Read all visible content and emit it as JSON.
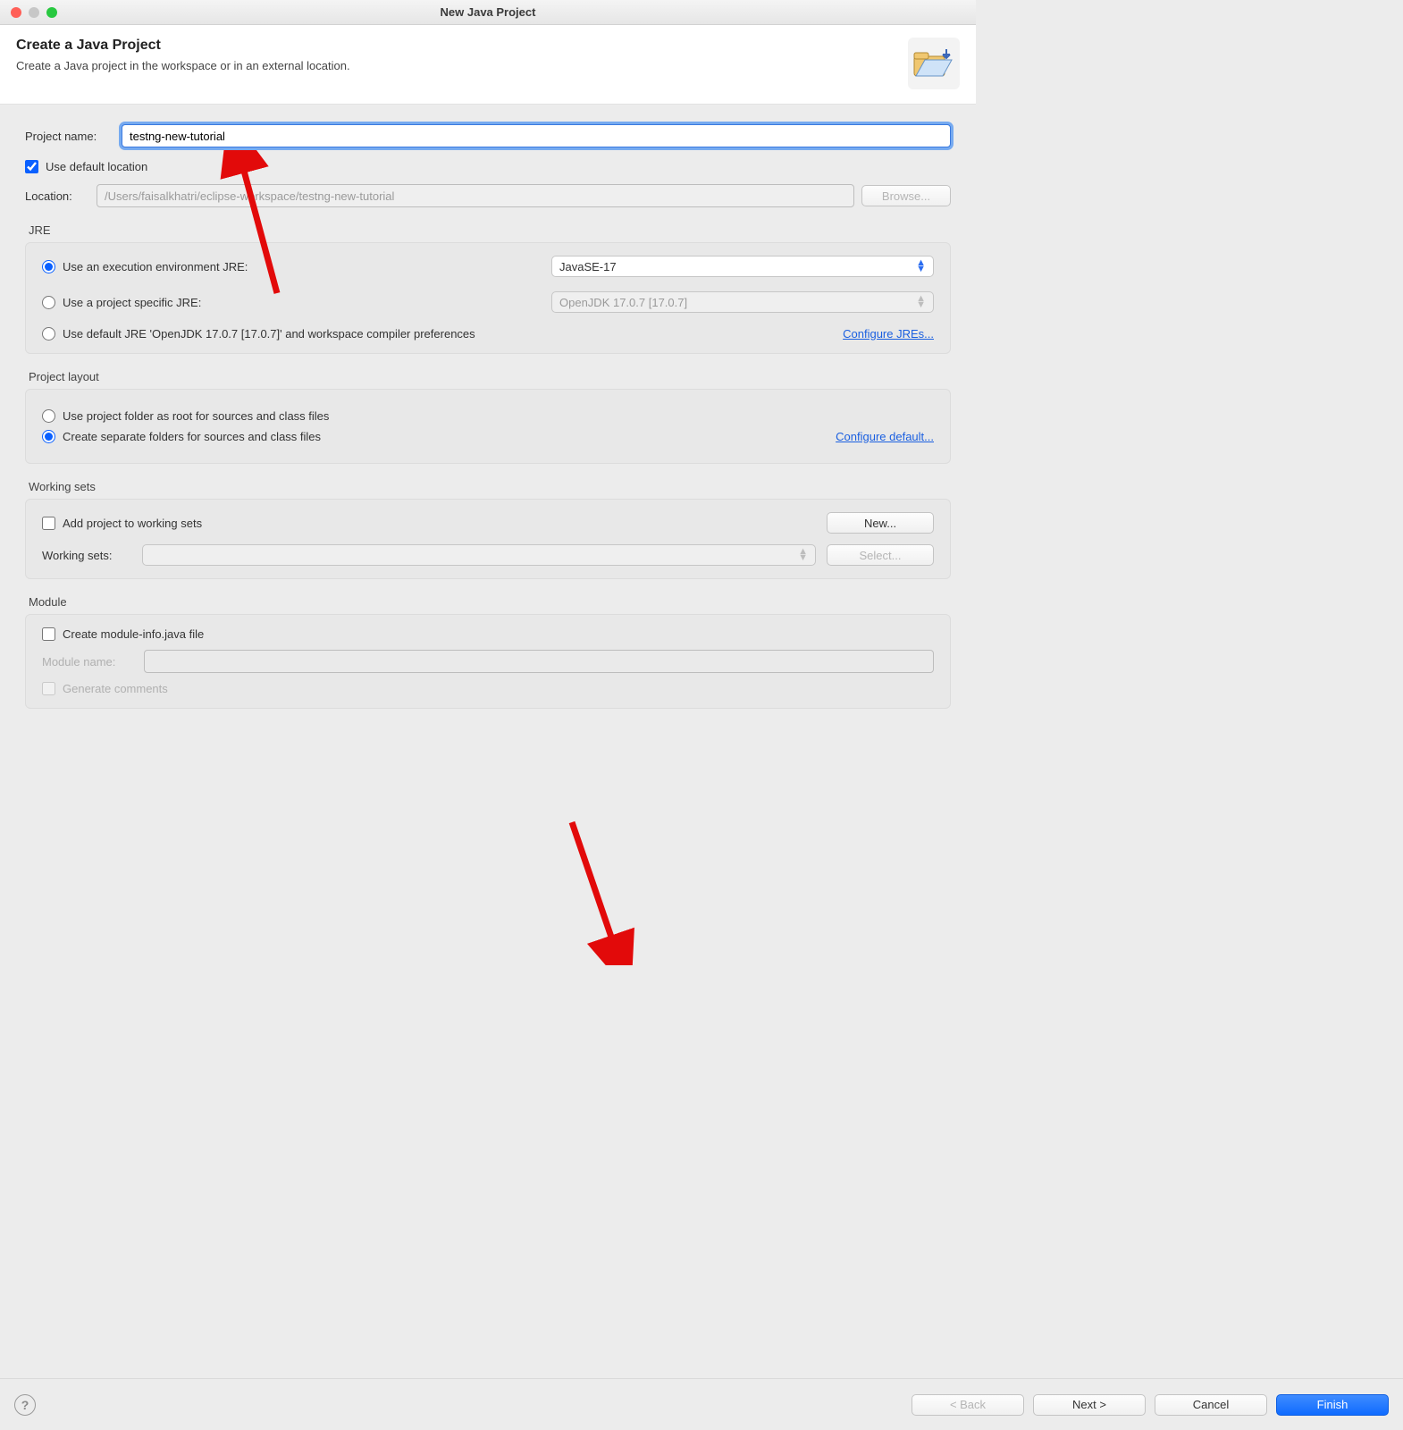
{
  "window": {
    "title": "New Java Project",
    "trafficLights": {
      "close": "#ff5f57",
      "min": "#c7c7c7",
      "max": "#28c840"
    }
  },
  "banner": {
    "heading": "Create a Java Project",
    "subheading": "Create a Java project in the workspace or in an external location."
  },
  "projectName": {
    "label": "Project name:",
    "value": "testng-new-tutorial"
  },
  "defaultLocation": {
    "label": "Use default location",
    "checked": true
  },
  "location": {
    "label": "Location:",
    "value": "/Users/faisalkhatri/eclipse-workspace/testng-new-tutorial",
    "browse": "Browse..."
  },
  "jre": {
    "title": "JRE",
    "useExecEnv": {
      "label": "Use an execution environment JRE:",
      "checked": true,
      "value": "JavaSE-17"
    },
    "useProject": {
      "label": "Use a project specific JRE:",
      "value": "OpenJDK 17.0.7 [17.0.7]"
    },
    "useDefault": {
      "label": "Use default JRE 'OpenJDK 17.0.7 [17.0.7]' and workspace compiler preferences"
    },
    "configure": "Configure JREs..."
  },
  "layout": {
    "title": "Project layout",
    "opt1": "Use project folder as root for sources and class files",
    "opt2": "Create separate folders for sources and class files",
    "configure": "Configure default..."
  },
  "workingSets": {
    "title": "Working sets",
    "addLabel": "Add project to working sets",
    "newBtn": "New...",
    "label": "Working sets:",
    "selectBtn": "Select..."
  },
  "module": {
    "title": "Module",
    "createLabel": "Create module-info.java file",
    "nameLabel": "Module name:",
    "generateLabel": "Generate comments"
  },
  "footer": {
    "back": "< Back",
    "next": "Next >",
    "cancel": "Cancel",
    "finish": "Finish"
  }
}
